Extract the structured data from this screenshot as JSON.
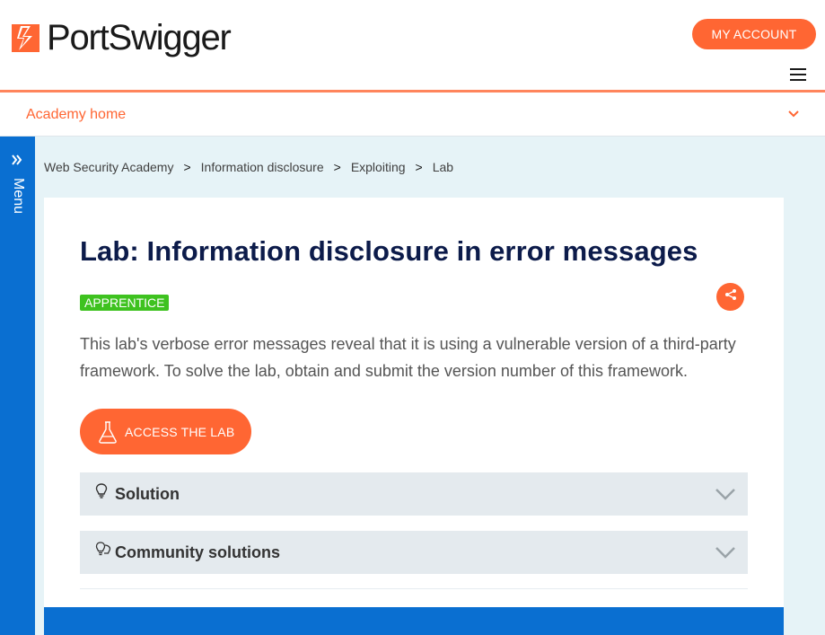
{
  "header": {
    "logo_text": "PortSwigger",
    "my_account_label": "MY ACCOUNT",
    "menu_icon": "hamburger-icon"
  },
  "academy_bar": {
    "label": "Academy home",
    "chevron_icon": "chevron-down-icon"
  },
  "side_menu": {
    "label": "Menu",
    "icon": "double-chevron-right-icon"
  },
  "breadcrumb": {
    "items": [
      "Web Security Academy",
      "Information disclosure",
      "Exploiting",
      "Lab"
    ],
    "separator": ">"
  },
  "lab": {
    "title": "Lab: Information disclosure in error messages",
    "level": "APPRENTICE",
    "description": "This lab's verbose error messages reveal that it is using a vulnerable version of a third-party framework. To solve the lab, obtain and submit the version number of this framework.",
    "access_label": "ACCESS THE LAB",
    "share_icon": "share-icon",
    "access_icon": "flask-icon"
  },
  "accordions": [
    {
      "label": "Solution",
      "icon": "lightbulb-icon"
    },
    {
      "label": "Community solutions",
      "icon": "lightbulbs-icon"
    }
  ],
  "colors": {
    "accent": "#ff6633",
    "brand_blue": "#0a6fd1",
    "badge_green": "#3ec21f",
    "title_navy": "#0c1b4a",
    "content_bg": "#e6f3f7"
  }
}
